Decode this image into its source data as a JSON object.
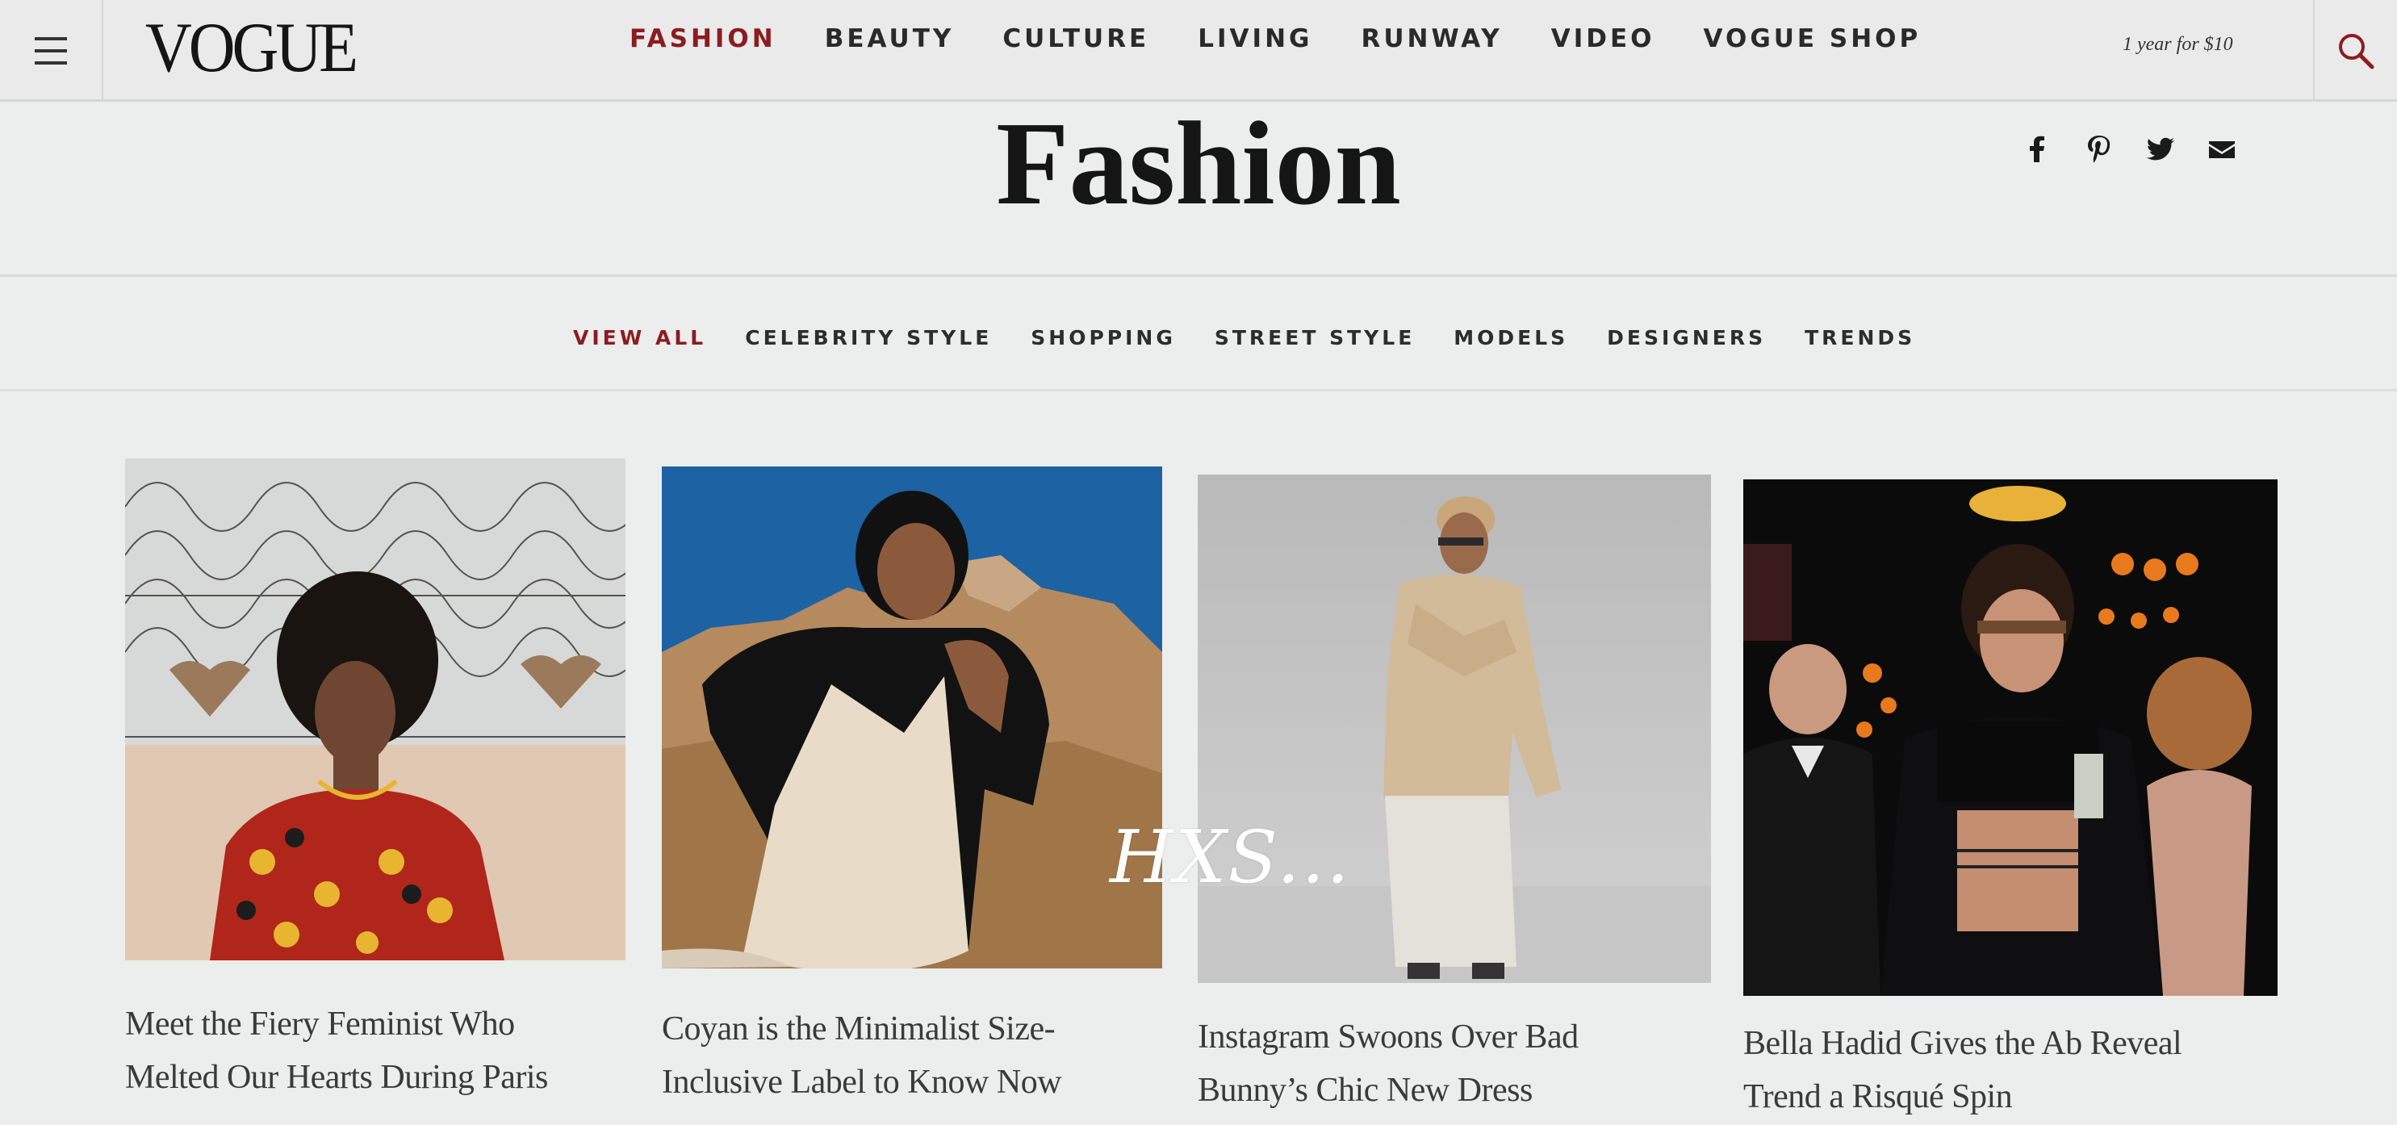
{
  "header": {
    "logo": "VOGUE",
    "nav": [
      "FASHION",
      "BEAUTY",
      "CULTURE",
      "LIVING",
      "RUNWAY",
      "VIDEO",
      "VOGUE SHOP"
    ],
    "active_nav": "FASHION",
    "subscribe": "1 year for $10"
  },
  "page": {
    "title": "Fashion",
    "social": [
      "facebook-icon",
      "pinterest-icon",
      "twitter-icon",
      "email-icon"
    ]
  },
  "subnav": {
    "items": [
      "VIEW ALL",
      "CELEBRITY STYLE",
      "SHOPPING",
      "STREET STYLE",
      "MODELS",
      "DESIGNERS",
      "TRENDS"
    ],
    "active": "VIEW ALL"
  },
  "articles": [
    {
      "headline_lines": [
        "Meet the Fiery Feminist Who",
        "Melted Our Hearts During Paris"
      ]
    },
    {
      "headline_lines": [
        "Coyan is the Minimalist Size-",
        "Inclusive Label to Know Now"
      ]
    },
    {
      "headline_lines": [
        "Instagram Swoons Over Bad",
        "Bunny’s Chic New Dress"
      ]
    },
    {
      "headline_lines": [
        "Bella Hadid Gives the Ab Reveal",
        "Trend a Risqué Spin"
      ]
    }
  ],
  "watermark": "HXS...",
  "colors": {
    "accent": "#8c1c21",
    "background": "#eceeed",
    "text": "#1a1a1a"
  }
}
